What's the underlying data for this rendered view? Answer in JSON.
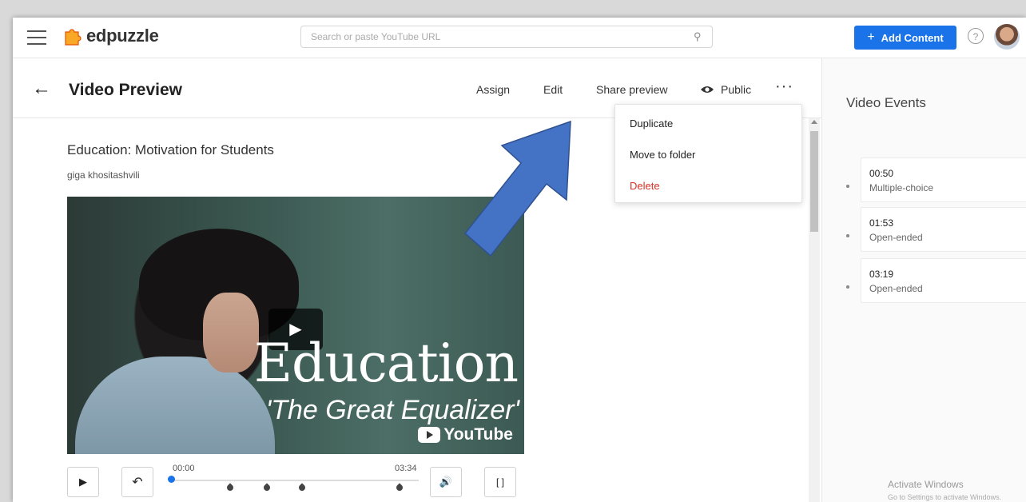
{
  "app": {
    "name": "edpuzzle"
  },
  "search": {
    "placeholder": "Search or paste YouTube URL"
  },
  "nav": {
    "add_content": "Add Content",
    "help": "?"
  },
  "header": {
    "title": "Video Preview",
    "actions": [
      "Assign",
      "Edit",
      "Share preview",
      "Public"
    ],
    "more": "···"
  },
  "menu": {
    "items": [
      "Duplicate",
      "Move to folder",
      "Delete"
    ]
  },
  "video": {
    "title": "Education: Motivation for Students",
    "author": "giga khositashvili",
    "overlay_title": "Education",
    "overlay_subtitle": "'The Great Equalizer'",
    "brand": "YouTube",
    "current_time": "00:00",
    "duration": "03:34"
  },
  "panel": {
    "title": "Video Events",
    "events": [
      {
        "time": "00:50",
        "kind": "Multiple-choice"
      },
      {
        "time": "01:53",
        "kind": "Open-ended"
      },
      {
        "time": "03:19",
        "kind": "Open-ended"
      }
    ]
  },
  "watermark": {
    "line1": "Activate Windows",
    "line2": "Go to Settings to activate Windows."
  },
  "colors": {
    "accent": "#1a73e8",
    "delete": "#d93025",
    "arrow": "#4472c4"
  }
}
